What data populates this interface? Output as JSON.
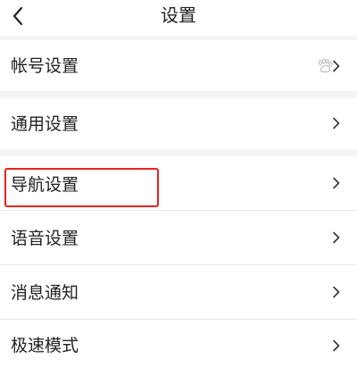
{
  "header": {
    "title": "设置",
    "back_icon": "chevron-left-icon"
  },
  "settings": {
    "account": {
      "label": "帐号设置",
      "icon": "baidu-paw-icon",
      "chevron": "chevron-right-icon"
    },
    "general": {
      "label": "通用设置",
      "chevron": "chevron-right-icon"
    },
    "navigation": {
      "label": "导航设置",
      "chevron": "chevron-right-icon",
      "highlighted": true
    },
    "voice": {
      "label": "语音设置",
      "chevron": "chevron-right-icon"
    },
    "notifications": {
      "label": "消息通知",
      "chevron": "chevron-right-icon"
    },
    "speed_mode": {
      "label": "极速模式",
      "chevron": "chevron-right-icon"
    }
  },
  "colors": {
    "highlight": "#e8231f",
    "text": "#222222",
    "separator": "#f4f4f4"
  }
}
